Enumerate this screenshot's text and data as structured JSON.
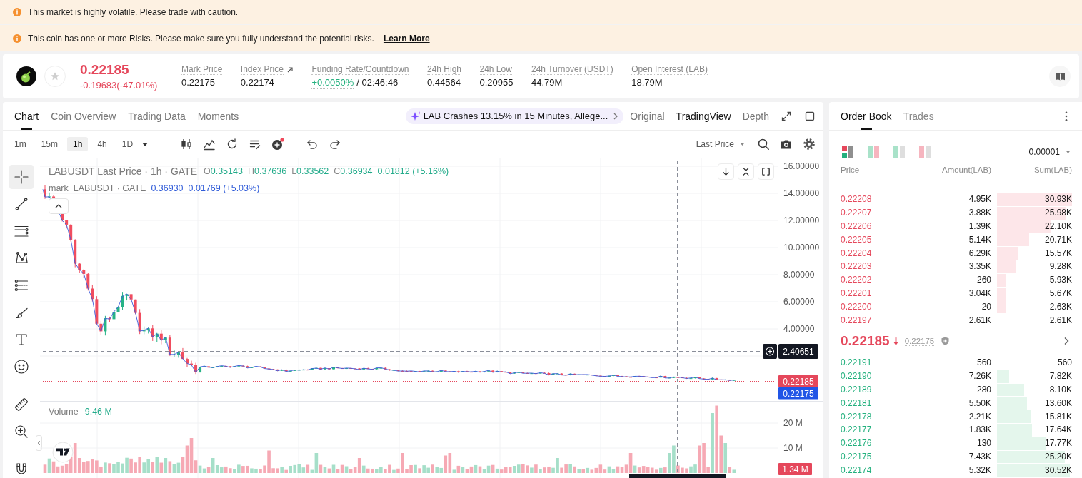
{
  "banners": [
    {
      "text": "This market is highly volatile. Please trade with caution."
    },
    {
      "text": "This coin has one or more Risks. Please make sure you fully understand the potential risks.",
      "link": "Learn More"
    }
  ],
  "ticker": {
    "price": "0.22185",
    "falling": true,
    "change": "-0.19683(-47.01%)",
    "favorite": false,
    "stats": [
      {
        "label": "Mark Price",
        "value": "0.22175",
        "positive": false,
        "external": false
      },
      {
        "label": "Index Price",
        "value": "0.22174",
        "positive": false,
        "external": true
      },
      {
        "label": "Funding Rate/Countdown",
        "value": "+0.0050%",
        "positive": true,
        "suffix": "/ 02:46:46",
        "external": false
      },
      {
        "label": "24h High",
        "value": "0.44564",
        "positive": false,
        "external": false
      },
      {
        "label": "24h Low",
        "value": "0.20955",
        "positive": false,
        "external": false
      },
      {
        "label": "24h Turnover (USDT)",
        "value": "44.79M",
        "positive": false,
        "external": false
      },
      {
        "label": "Open Interest (LAB)",
        "value": "18.79M",
        "positive": false,
        "external": false
      }
    ]
  },
  "chart_panel": {
    "tabs": [
      {
        "label": "Chart",
        "selected": true
      },
      {
        "label": "Coin Overview",
        "selected": false
      },
      {
        "label": "Trading Data",
        "selected": false
      },
      {
        "label": "Moments",
        "selected": false
      }
    ],
    "news": "LAB Crashes 13.15% in 15 Minutes, Allege...",
    "views": [
      {
        "label": "Original",
        "selected": false
      },
      {
        "label": "TradingView",
        "selected": true
      },
      {
        "label": "Depth",
        "selected": false
      }
    ],
    "intervals": [
      {
        "label": "1m",
        "selected": false
      },
      {
        "label": "15m",
        "selected": false
      },
      {
        "label": "1h",
        "selected": true
      },
      {
        "label": "4h",
        "selected": false
      },
      {
        "label": "1D",
        "selected": false
      }
    ],
    "price_source": "Last Price",
    "tools": [
      {
        "kind": "crosshair",
        "selected": true
      },
      {
        "kind": "trend-line",
        "selected": false
      },
      {
        "kind": "parallel-lines",
        "selected": false
      },
      {
        "kind": "pattern",
        "selected": false
      },
      {
        "kind": "fibonacci",
        "selected": false
      },
      {
        "kind": "brush",
        "selected": false
      },
      {
        "kind": "text",
        "selected": false
      },
      {
        "kind": "emoji",
        "selected": false
      },
      {
        "kind": "ruler",
        "selected": false
      },
      {
        "kind": "zoom",
        "selected": false
      },
      {
        "kind": "magnet",
        "selected": false
      }
    ],
    "legend": {
      "title": "LABUSDT Last Price · 1h · GATE",
      "ohlc": [
        {
          "key": "O",
          "value": "0.35143"
        },
        {
          "key": "H",
          "value": "0.37636"
        },
        {
          "key": "L",
          "value": "0.33562"
        },
        {
          "key": "C",
          "value": "0.36934"
        }
      ],
      "change": "0.01812 (+5.16%)"
    },
    "mark_legend": {
      "title": "mark_LABUSDT · GATE",
      "value": "0.36930",
      "change": "0.01769 (+5.03%)"
    },
    "price_axis": [
      "16.00000",
      "14.00000",
      "12.00000",
      "10.00000",
      "8.00000",
      "6.00000",
      "4.00000"
    ],
    "crosshair_price": "2.40651",
    "last_price_tag": "0.22185",
    "mark_price_tag": "0.22175",
    "volume": {
      "label": "Volume",
      "value": "9.46 M",
      "axis": [
        "20 M",
        "10 M"
      ],
      "last_tag": "1.34 M"
    }
  },
  "order_book": {
    "tabs": [
      {
        "label": "Order Book",
        "selected": true
      },
      {
        "label": "Trades",
        "selected": false
      }
    ],
    "layouts": [
      {
        "kind": "combined",
        "selected": true
      },
      {
        "kind": "dual",
        "selected": false
      },
      {
        "kind": "bids",
        "selected": false
      },
      {
        "kind": "asks",
        "selected": false
      }
    ],
    "precision": "0.00001",
    "columns": [
      "Price",
      "Amount(LAB)",
      "Sum(LAB)"
    ],
    "asks": [
      {
        "price": "0.22208",
        "amount": "4.95K",
        "sum": "30.93K"
      },
      {
        "price": "0.22207",
        "amount": "3.88K",
        "sum": "25.98K"
      },
      {
        "price": "0.22206",
        "amount": "1.39K",
        "sum": "22.10K"
      },
      {
        "price": "0.22205",
        "amount": "5.14K",
        "sum": "20.71K"
      },
      {
        "price": "0.22204",
        "amount": "6.29K",
        "sum": "15.57K"
      },
      {
        "price": "0.22203",
        "amount": "3.35K",
        "sum": "9.28K"
      },
      {
        "price": "0.22202",
        "amount": "260",
        "sum": "5.93K"
      },
      {
        "price": "0.22201",
        "amount": "3.04K",
        "sum": "5.67K"
      },
      {
        "price": "0.22200",
        "amount": "20",
        "sum": "2.63K"
      },
      {
        "price": "0.22197",
        "amount": "2.61K",
        "sum": "2.61K"
      }
    ],
    "mid": {
      "price": "0.22185",
      "falling": true,
      "mark": "0.22175"
    },
    "bids": [
      {
        "price": "0.22191",
        "amount": "560",
        "sum": "560"
      },
      {
        "price": "0.22190",
        "amount": "7.26K",
        "sum": "7.82K"
      },
      {
        "price": "0.22189",
        "amount": "280",
        "sum": "8.10K"
      },
      {
        "price": "0.22181",
        "amount": "5.50K",
        "sum": "13.60K"
      },
      {
        "price": "0.22178",
        "amount": "2.21K",
        "sum": "15.81K"
      },
      {
        "price": "0.22177",
        "amount": "1.83K",
        "sum": "17.64K"
      },
      {
        "price": "0.22176",
        "amount": "130",
        "sum": "17.77K"
      },
      {
        "price": "0.22175",
        "amount": "7.43K",
        "sum": "25.20K"
      },
      {
        "price": "0.22174",
        "amount": "5.32K",
        "sum": "30.52K"
      }
    ]
  }
}
